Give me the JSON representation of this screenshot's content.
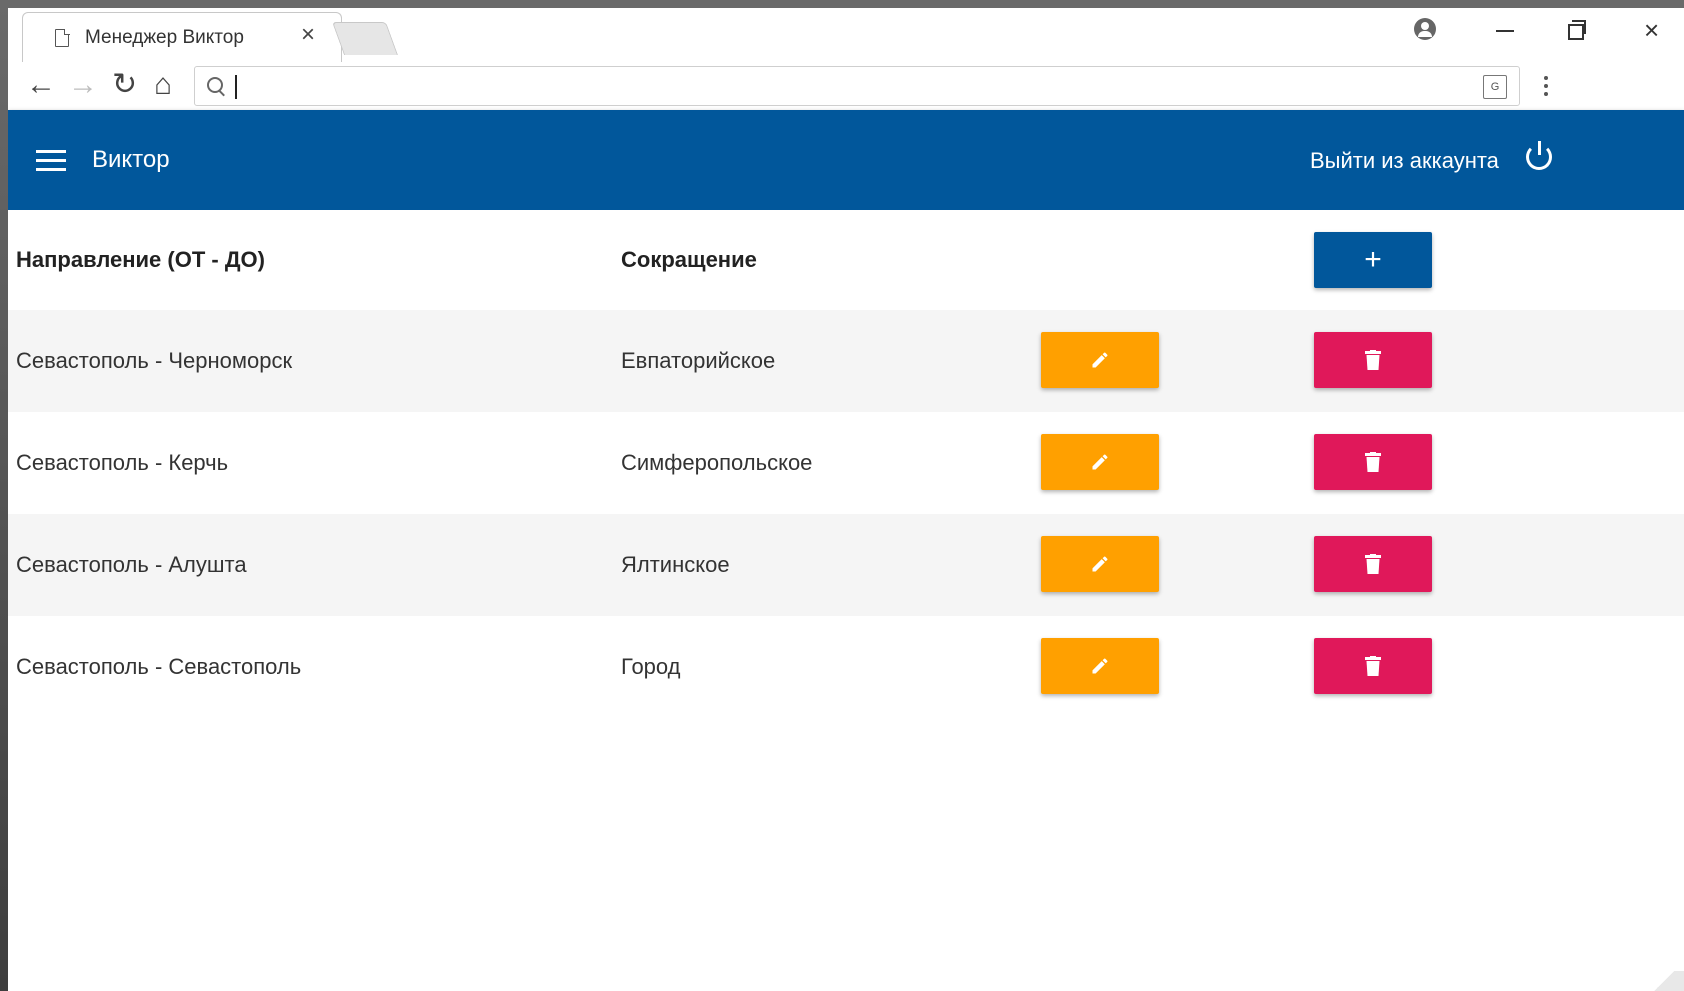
{
  "browser": {
    "tab_title": "Менеджер Виктор",
    "tab_close": "×",
    "address_value": "",
    "window_close": "×"
  },
  "app": {
    "title": "Виктор",
    "logout_label": "Выйти из аккаунта",
    "accent_color": "#01579b",
    "edit_color": "#ffa000",
    "delete_color": "#e0185a"
  },
  "table": {
    "headers": {
      "direction": "Направление (ОТ - ДО)",
      "abbreviation": "Сокращение",
      "add_label": "+"
    },
    "rows": [
      {
        "direction": "Севастополь - Черноморск",
        "abbreviation": "Евпаторийское"
      },
      {
        "direction": "Севастополь - Керчь",
        "abbreviation": "Симферопольское"
      },
      {
        "direction": "Севастополь - Алушта",
        "abbreviation": "Ялтинское"
      },
      {
        "direction": "Севастополь - Севастополь",
        "abbreviation": "Город"
      }
    ]
  },
  "icons": {
    "edit": "pencil-icon",
    "delete": "trash-icon",
    "menu": "hamburger-icon",
    "logout": "power-icon"
  }
}
